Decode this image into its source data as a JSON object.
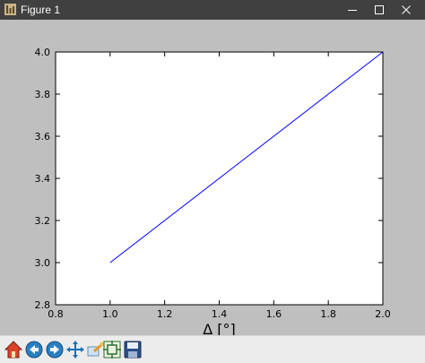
{
  "window": {
    "title": "Figure 1"
  },
  "toolbar": {
    "buttons": [
      {
        "name": "home",
        "icon": "home-icon"
      },
      {
        "name": "back",
        "icon": "back-arrow-icon"
      },
      {
        "name": "forward",
        "icon": "forward-arrow-icon"
      },
      {
        "name": "pan",
        "icon": "pan-arrows-icon"
      },
      {
        "name": "zoom",
        "icon": "zoom-rectangle-icon"
      },
      {
        "name": "configure-subplots",
        "icon": "subplots-icon"
      },
      {
        "name": "save",
        "icon": "save-disk-icon"
      }
    ]
  },
  "chart_data": {
    "type": "line",
    "title": "",
    "xlabel": "Δ [°]",
    "ylabel": "",
    "xlim": [
      0.8,
      2.0
    ],
    "ylim": [
      2.8,
      4.0
    ],
    "xticks": [
      "0.8",
      "1.0",
      "1.2",
      "1.4",
      "1.6",
      "1.8",
      "2.0"
    ],
    "yticks": [
      "2.8",
      "3.0",
      "3.2",
      "3.4",
      "3.6",
      "3.8",
      "4.0"
    ],
    "series": [
      {
        "x": [
          1.0,
          2.0
        ],
        "y": [
          3.0,
          4.0
        ],
        "color": "#0000ff"
      }
    ],
    "grid": false,
    "legend": "none"
  },
  "colors": {
    "titlebar": "#404040",
    "figure_background": "#bfbfbf",
    "axes_background": "#ffffff",
    "toolbar": "#ececec",
    "line": "#0000ff"
  }
}
